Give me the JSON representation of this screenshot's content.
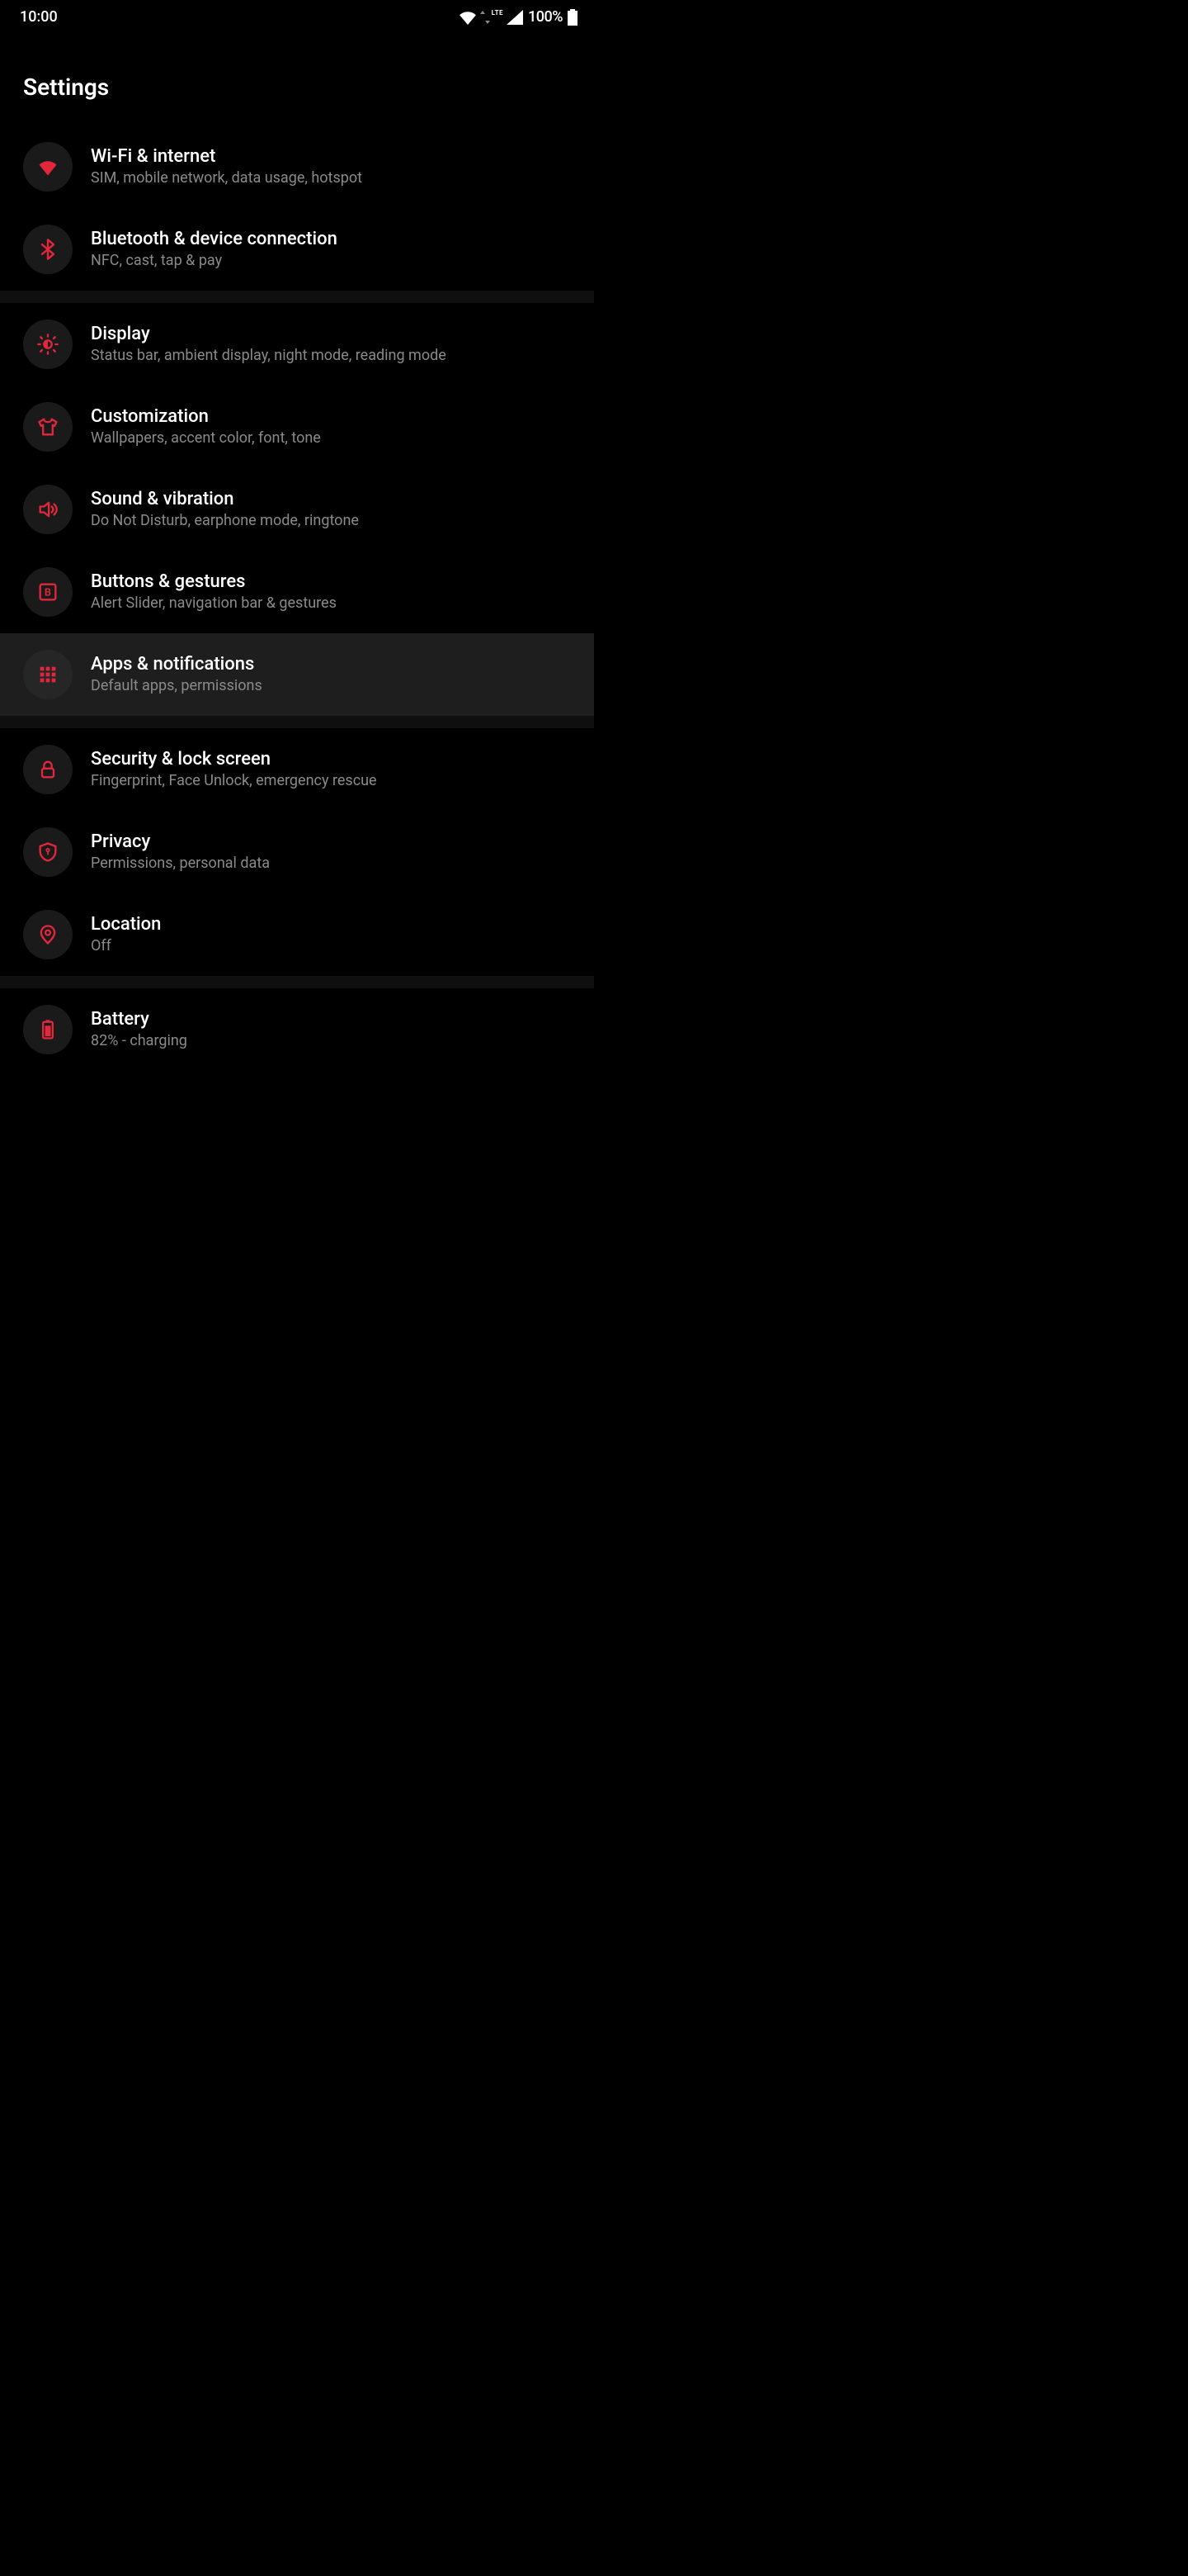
{
  "status": {
    "time": "10:00",
    "battery_pct": "100%",
    "network_label": "LTE"
  },
  "page": {
    "title": "Settings"
  },
  "items": {
    "wifi": {
      "title": "Wi-Fi & internet",
      "sub": "SIM, mobile network, data usage, hotspot"
    },
    "bluetooth": {
      "title": "Bluetooth & device connection",
      "sub": "NFC, cast, tap & pay"
    },
    "display": {
      "title": "Display",
      "sub": "Status bar, ambient display, night mode, reading mode"
    },
    "customization": {
      "title": "Customization",
      "sub": "Wallpapers, accent color, font, tone"
    },
    "sound": {
      "title": "Sound & vibration",
      "sub": "Do Not Disturb, earphone mode, ringtone"
    },
    "buttons": {
      "title": "Buttons & gestures",
      "sub": "Alert Slider, navigation bar & gestures"
    },
    "apps": {
      "title": "Apps & notifications",
      "sub": "Default apps, permissions"
    },
    "security": {
      "title": "Security & lock screen",
      "sub": "Fingerprint, Face Unlock, emergency rescue"
    },
    "privacy": {
      "title": "Privacy",
      "sub": "Permissions, personal data"
    },
    "location": {
      "title": "Location",
      "sub": "Off"
    },
    "battery": {
      "title": "Battery",
      "sub": "82% - charging"
    }
  }
}
